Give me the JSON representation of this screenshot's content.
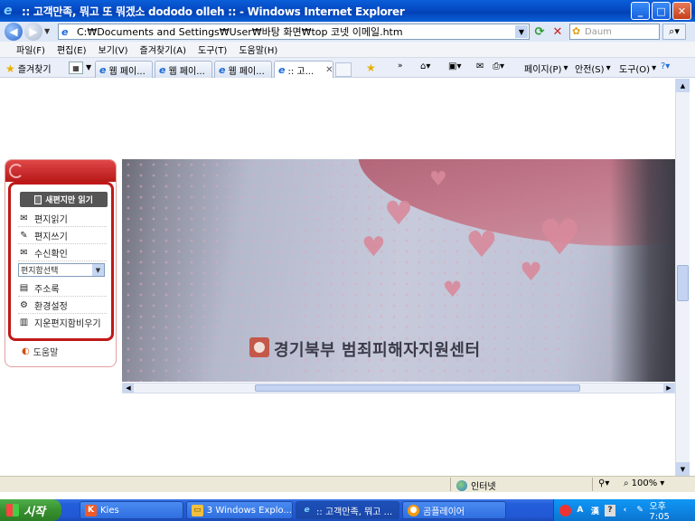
{
  "window": {
    "title": ":: 고객만족, 뭐고 또 뭐겠소 dododo olleh :: - Windows Internet Explorer",
    "min": "_",
    "max": "□",
    "close": "✕"
  },
  "address": {
    "url": "C:₩Documents and Settings₩User₩바탕 화면₩top 코넷 이메일.htm",
    "search_placeholder": "Daum"
  },
  "menu": [
    "파일(F)",
    "편집(E)",
    "보기(V)",
    "즐겨찾기(A)",
    "도구(T)",
    "도움말(H)"
  ],
  "tabs_bar": {
    "favorites": "즐겨찾기",
    "tabs": [
      {
        "label": "웹 페이..."
      },
      {
        "label": "웹 페이..."
      },
      {
        "label": "웹 페이..."
      },
      {
        "label": ":: 고..."
      }
    ],
    "tools": {
      "page": "페이지(P)",
      "safety": "안전(S)",
      "tools": "도구(O)"
    }
  },
  "sidebar": {
    "read_new": "새편지만 읽기",
    "items": [
      {
        "label": "편지읽기",
        "icon": "envelope-icon"
      },
      {
        "label": "편지쓰기",
        "icon": "pencil-icon"
      },
      {
        "label": "수신확인",
        "icon": "receipt-icon"
      }
    ],
    "folder_select": "편지함선택",
    "items2": [
      {
        "label": "주소록",
        "icon": "addressbook-icon"
      },
      {
        "label": "환경설정",
        "icon": "settings-icon"
      },
      {
        "label": "지운편지함비우기",
        "icon": "trash-icon"
      }
    ],
    "help": "도움말"
  },
  "photo": {
    "caption": "경기북부 범죄피해자지원센터"
  },
  "status": {
    "zone": "인터넷",
    "zoom": "100%"
  },
  "taskbar": {
    "start": "시작",
    "tasks": [
      {
        "label": "Kies"
      },
      {
        "label": "3 Windows Explo..."
      },
      {
        "label": ":: 고객만족, 뭐고 ..."
      },
      {
        "label": "곰플레이어"
      }
    ],
    "tray_lang": "A",
    "tray_hanja": "漢",
    "clock": "오후 7:05"
  }
}
